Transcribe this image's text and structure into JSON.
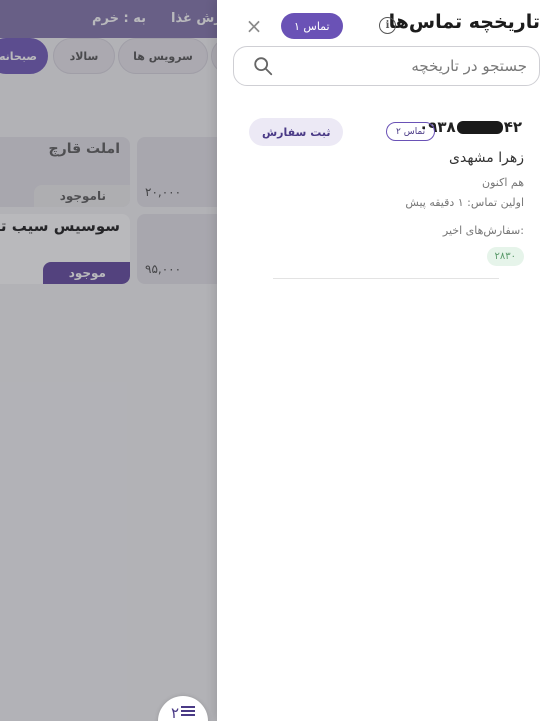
{
  "background": {
    "header": {
      "title_partial": "ارش غذا",
      "branch": "به : خرم"
    },
    "categories": [
      {
        "label": "صبحانه",
        "active": true
      },
      {
        "label": "سالاد",
        "active": false
      },
      {
        "label": "سرویس ها",
        "active": false
      },
      {
        "label": "",
        "active": false
      }
    ],
    "products": [
      {
        "name": "املت قارچ",
        "stock": "ناموجود",
        "price": ""
      },
      {
        "name": "",
        "stock": "",
        "price": "۲۰,۰۰۰"
      },
      {
        "name": "سوسیس سیب تخم",
        "stock": "موجود",
        "price": ""
      },
      {
        "name": "",
        "stock": "",
        "price": "۹۵,۰۰۰"
      }
    ],
    "fab": {
      "icon": "menu-icon",
      "count": "۲"
    }
  },
  "drawer": {
    "title": "تاریخچه تماس‌ها",
    "info_icon": "info-icon",
    "count_badge": "۱ تماس",
    "close_icon": "close-icon",
    "search": {
      "placeholder": "جستجو در تاریخچه",
      "value": ""
    },
    "entries": [
      {
        "phone_prefix": "۰۹۳۸",
        "phone_suffix": "۴۲",
        "call_count": "۲ تماس",
        "order_button": "ثبت سفارش",
        "name": "زهرا مشهدی",
        "last_seen": "هم اکنون",
        "first_call": "اولین تماس: ۱ دقیقه پیش",
        "recent_orders_label": "سفارش‌های اخیر:",
        "recent_orders": [
          "۲۸۳۰"
        ]
      }
    ]
  },
  "colors": {
    "accent": "#6a52b6",
    "accent_light": "#ece9f5",
    "order_chip_bg": "#e6f4ea",
    "order_chip_text": "#5a9a6a"
  }
}
